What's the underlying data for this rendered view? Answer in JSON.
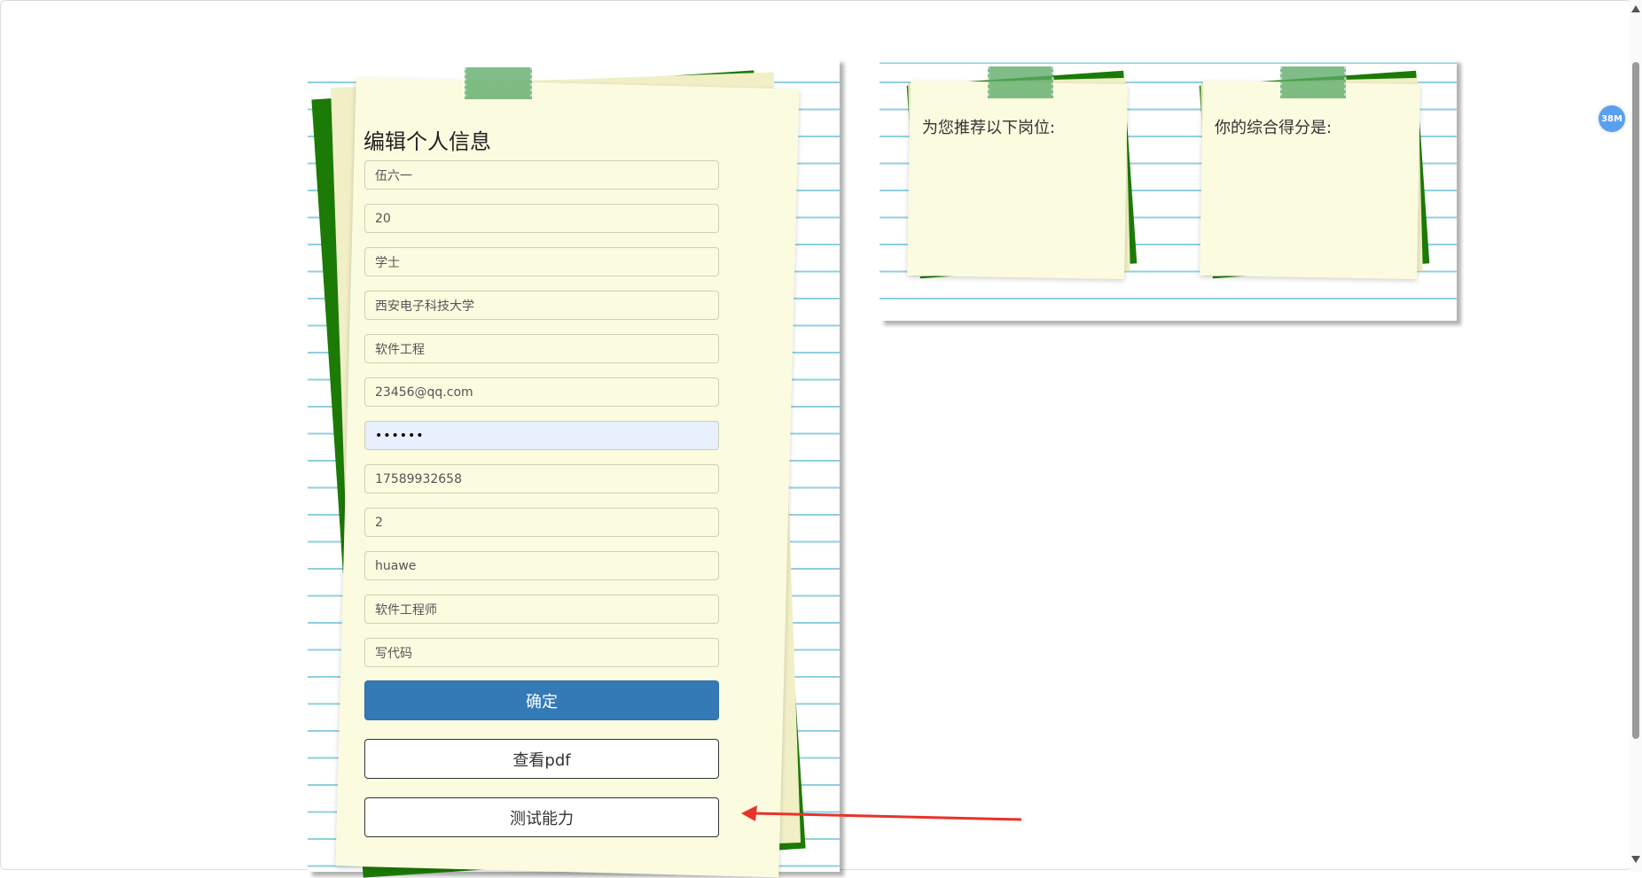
{
  "form": {
    "title": "编辑个人信息",
    "fields": [
      {
        "name": "name-field",
        "value": "伍六一"
      },
      {
        "name": "age-field",
        "value": "20"
      },
      {
        "name": "degree-field",
        "value": "学士"
      },
      {
        "name": "school-field",
        "value": "西安电子科技大学"
      },
      {
        "name": "major-field",
        "value": "软件工程"
      },
      {
        "name": "email-field",
        "value": "23456@qq.com"
      },
      {
        "name": "password-field",
        "value": "••••••"
      },
      {
        "name": "phone-field",
        "value": "17589932658"
      },
      {
        "name": "experience-field",
        "value": "2"
      },
      {
        "name": "company-field",
        "value": "huawe"
      },
      {
        "name": "position-field",
        "value": "软件工程师"
      },
      {
        "name": "skills-field",
        "value": "写代码"
      }
    ],
    "confirm_label": "确定",
    "view_pdf_label": "查看pdf",
    "test_ability_label": "测试能力"
  },
  "notes": {
    "recommend_label": "为您推荐以下岗位:",
    "score_label": "你的综合得分是:"
  },
  "badge": {
    "text": "38M"
  },
  "colors": {
    "primary_button": "#337ab7",
    "note_paper": "#fbfbe0",
    "back_sheet": "#1c7a06",
    "tape": "#5caa68",
    "annotation_arrow": "#e8332a"
  }
}
